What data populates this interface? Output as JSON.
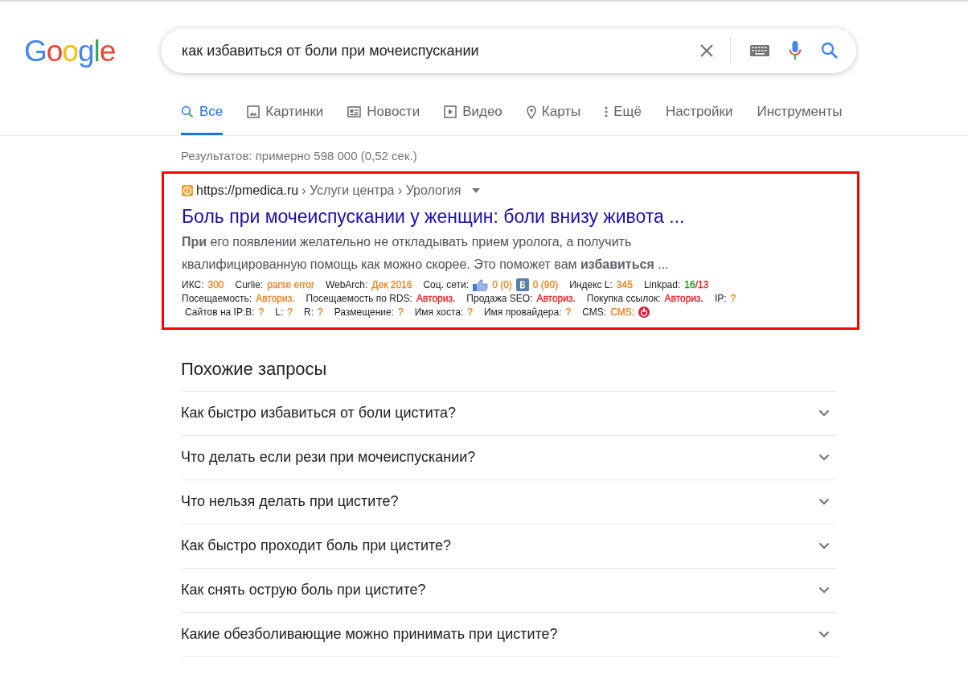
{
  "logo": "Google",
  "search": {
    "value": "как избавиться от боли при мочеиспускании"
  },
  "tabs": [
    {
      "label": "Все",
      "kind": "search",
      "selected": true
    },
    {
      "label": "Картинки",
      "kind": "image",
      "selected": false
    },
    {
      "label": "Новости",
      "kind": "news",
      "selected": false
    },
    {
      "label": "Видео",
      "kind": "video",
      "selected": false
    },
    {
      "label": "Карты",
      "kind": "pin",
      "selected": false
    },
    {
      "label": "Ещё",
      "kind": "more",
      "selected": false
    },
    {
      "label": "Настройки",
      "kind": "plain",
      "selected": false
    },
    {
      "label": "Инструменты",
      "kind": "plain",
      "selected": false
    }
  ],
  "result_stats": "Результатов: примерно 598 000 (0,52 сек.)",
  "result": {
    "url": "https://pmedica.ru",
    "breadcrumb": "› Услуги центра › Урология",
    "title": "Боль при мочеиспускании у женщин: боли внизу живота ...",
    "snippet": "**При** его появлении желательно не откладывать прием уролога, а получить квалифицированную помощь как можно скорее. Это поможет вам **избавиться** ...",
    "seo_lines": [
      [
        {
          "label": "ИКС:",
          "values": [
            {
              "text": "300",
              "color": "#e8892a",
              "kind": "text"
            }
          ]
        },
        {
          "label": "Curlie:",
          "values": [
            {
              "text": "parse error",
              "color": "#e8892a",
              "kind": "text"
            }
          ]
        },
        {
          "label": "WebArch:",
          "values": [
            {
              "text": "Дек 2016",
              "color": "#e8892a",
              "kind": "text"
            }
          ]
        },
        {
          "label": "Соц. сети:",
          "values": [
            {
              "text": "0 (0)",
              "color": "#e8892a",
              "kind": "like"
            },
            {
              "text": "0 (90)",
              "color": "#e8892a",
              "kind": "vk"
            }
          ]
        },
        {
          "label": "Индекс L:",
          "values": [
            {
              "text": "345",
              "color": "#e8892a",
              "kind": "text"
            }
          ]
        },
        {
          "label": "Linkpad:",
          "values": [
            {
              "text": "16",
              "color": "#1a9c1a",
              "kind": "text"
            },
            {
              "text": "/13",
              "color": "#e8262a",
              "kind": "text"
            }
          ]
        }
      ],
      [
        {
          "label": "Посещаемость:",
          "values": [
            {
              "text": "Авториз.",
              "color": "#e8892a",
              "kind": "text"
            }
          ]
        },
        {
          "label": "Посещаемость по RDS:",
          "values": [
            {
              "text": "Авториз.",
              "color": "#e8262a",
              "kind": "text"
            }
          ]
        },
        {
          "label": "Продажа SEO:",
          "values": [
            {
              "text": "Авториз.",
              "color": "#e8262a",
              "kind": "text"
            }
          ]
        },
        {
          "label": "Покупка ссылок:",
          "values": [
            {
              "text": "Авториз.",
              "color": "#e8262a",
              "kind": "text"
            }
          ]
        },
        {
          "label": "IP:",
          "values": [
            {
              "text": "?",
              "color": "#e8892a",
              "kind": "text"
            }
          ]
        }
      ],
      [
        {
          "label": "Сайтов на IP:B:",
          "values": [
            {
              "text": "?",
              "color": "#e8892a",
              "kind": "text"
            }
          ]
        },
        {
          "label": "L:",
          "values": [
            {
              "text": "?",
              "color": "#e8892a",
              "kind": "text"
            }
          ]
        },
        {
          "label": "R:",
          "values": [
            {
              "text": "?",
              "color": "#e8892a",
              "kind": "text"
            }
          ]
        },
        {
          "label": "Размещение:",
          "values": [
            {
              "text": "?",
              "color": "#e8892a",
              "kind": "text"
            }
          ]
        },
        {
          "label": "Имя хоста:",
          "values": [
            {
              "text": "?",
              "color": "#e8892a",
              "kind": "text"
            }
          ]
        },
        {
          "label": "Имя провайдера:",
          "values": [
            {
              "text": "?",
              "color": "#e8892a",
              "kind": "text"
            }
          ]
        },
        {
          "label": "CMS:",
          "values": [
            {
              "text": "CMS:",
              "color": "#e8892a",
              "kind": "cms"
            }
          ]
        }
      ]
    ]
  },
  "related": {
    "title": "Похожие запросы",
    "items": [
      {
        "label": "Как быстро избавиться от боли цистита?",
        "expanded": false
      },
      {
        "label": "Что делать если рези при мочеиспускании?",
        "expanded": false
      },
      {
        "label": "Что нельзя делать при цистите?",
        "expanded": false
      },
      {
        "label": "Как быстро проходит боль при цистите?",
        "expanded": false
      },
      {
        "label": "Как снять острую боль при цистите?",
        "expanded": false
      },
      {
        "label": "Какие обезболивающие можно принимать при цистите?",
        "expanded": false
      }
    ]
  }
}
